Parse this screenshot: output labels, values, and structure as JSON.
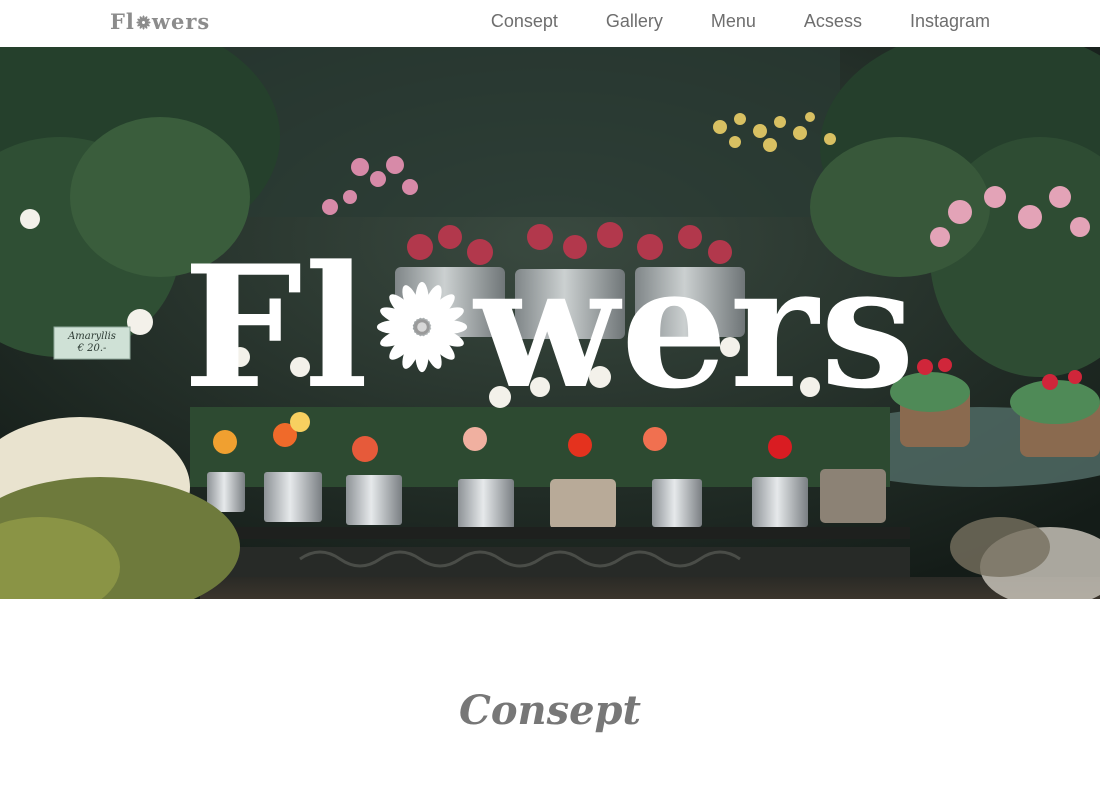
{
  "brand": {
    "logo_prefix": "Fl",
    "logo_suffix": "wers",
    "logo_color": "#8c8c8c",
    "flower_icon": "daisy-icon"
  },
  "nav": {
    "items": [
      {
        "label": "Consept"
      },
      {
        "label": "Gallery"
      },
      {
        "label": "Menu"
      },
      {
        "label": "Acsess"
      },
      {
        "label": "Instagram"
      }
    ],
    "text_color": "#6e6e6e"
  },
  "hero": {
    "title_prefix": "Fl",
    "title_suffix": "wers",
    "title_color": "#ffffff",
    "image_description_icon": "flower-shop-photo",
    "price_tag": {
      "name": "Amaryllis",
      "price": "€ 20.-"
    }
  },
  "section": {
    "heading": "Consept",
    "heading_color": "#777777"
  }
}
